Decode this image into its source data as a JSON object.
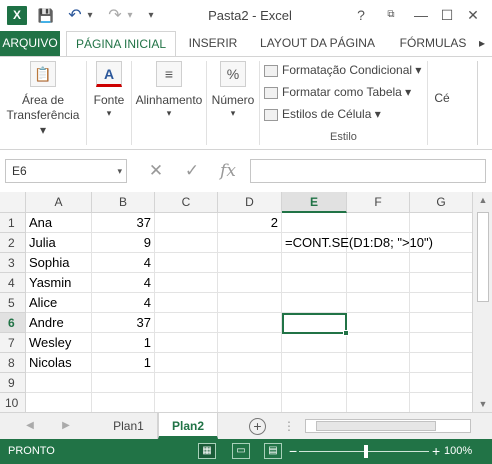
{
  "window": {
    "title": "Pasta2 - Excel",
    "help": "?",
    "minimize": "—",
    "restore": "☐",
    "close": "✕"
  },
  "quick_access": {
    "logo": "X",
    "save": "💾",
    "undo": "↶",
    "undo_menu": "▾",
    "redo": "↷",
    "redo_menu": "▾",
    "customize": "▾"
  },
  "tabs": {
    "file": "ARQUIVO",
    "items": [
      "PÁGINA INICIAL",
      "INSERIR",
      "LAYOUT DA PÁGINA",
      "FÓRMULAS"
    ]
  },
  "ribbon": {
    "clipboard": {
      "icon": "clipboard-icon",
      "label_line1": "Área de",
      "label_line2": "Transferência ▾",
      "glyph": "📋"
    },
    "font": {
      "icon": "font-color-icon",
      "label": "Fonte",
      "arrow": "▾",
      "glyph": "A"
    },
    "alignment": {
      "icon": "align-icon",
      "label": "Alinhamento",
      "arrow": "▾",
      "glyph": "≡"
    },
    "number": {
      "icon": "percent-icon",
      "label": "Número",
      "arrow": "▾",
      "glyph": "%"
    },
    "styles": {
      "conditional": "Formatação Condicional ▾",
      "as_table": "Formatar como Tabela ▾",
      "cell_styles": "Estilos de Célula ▾",
      "group_label": "Estilo"
    },
    "cells_partial": "Cé"
  },
  "formula_bar": {
    "name_box": "E6",
    "name_box_arrow": "▾",
    "cancel": "✕",
    "enter": "✓",
    "fx": "fx",
    "value": ""
  },
  "grid": {
    "columns": [
      "A",
      "B",
      "C",
      "D",
      "E",
      "F",
      "G"
    ],
    "rows": [
      "1",
      "2",
      "3",
      "4",
      "5",
      "6",
      "7",
      "8",
      "9",
      "10"
    ],
    "selected_column": "E",
    "selected_row": "6",
    "cells": {
      "A1": "Ana",
      "B1": "37",
      "D1": "2",
      "A2": "Julia",
      "B2": "9",
      "E2": "=CONT.SE(D1:D8; \">10\")",
      "A3": "Sophia",
      "B3": "4",
      "A4": "Yasmin",
      "B4": "4",
      "A5": "Alice",
      "B5": "4",
      "A6": "Andre",
      "B6": "37",
      "A7": "Wesley",
      "B7": "1",
      "A8": "Nicolas",
      "B8": "1"
    }
  },
  "sheets": {
    "prev": "◀",
    "next": "▶",
    "items": [
      "Plan1",
      "Plan2"
    ],
    "active": "Plan2",
    "add": "+"
  },
  "status": {
    "ready": "PRONTO",
    "zoom_minus": "−",
    "zoom_plus": "+",
    "zoom": "100%"
  },
  "colors": {
    "accent": "#217346",
    "status_bar": "#217346"
  }
}
